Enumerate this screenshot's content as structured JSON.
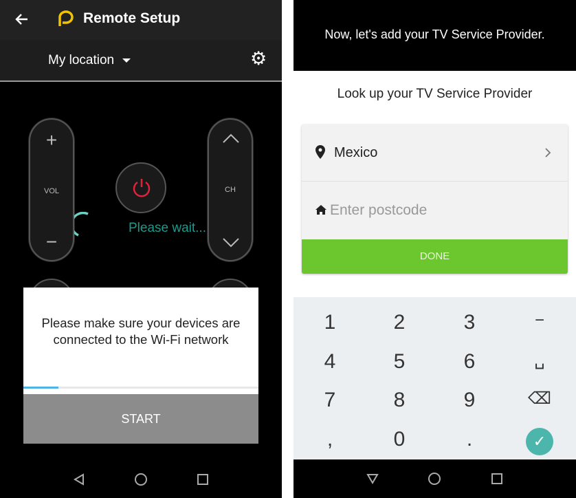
{
  "left": {
    "header": {
      "title": "Remote Setup",
      "back_icon": "arrow-left-icon",
      "logo_icon": "p-logo-icon",
      "logo_color": "#f2c300"
    },
    "location": {
      "label": "My location",
      "dropdown_icon": "caret-down-icon",
      "settings_icon": "gear-icon"
    },
    "remote": {
      "vol_label": "VOL",
      "ch_label": "CH",
      "power_color": "#e0223a"
    },
    "loading": {
      "text": "Please wait...",
      "color": "#1a9c8c"
    },
    "dialog": {
      "message": "Please make sure your devices are connected to the Wi-Fi network",
      "progress": 0.15,
      "button": "START"
    }
  },
  "right": {
    "banner": "Now, let's add your TV Service Provider.",
    "lookup_title": "Look up your TV Service Provider",
    "country": "Mexico",
    "postcode_placeholder": "Enter postcode",
    "done_button": "DONE",
    "accent": "#6cc62d",
    "keypad": [
      "1",
      "2",
      "3",
      "−",
      "4",
      "5",
      "6",
      "␣",
      "7",
      "8",
      "9",
      "⌫",
      ",",
      "0",
      ".",
      "✓"
    ]
  }
}
